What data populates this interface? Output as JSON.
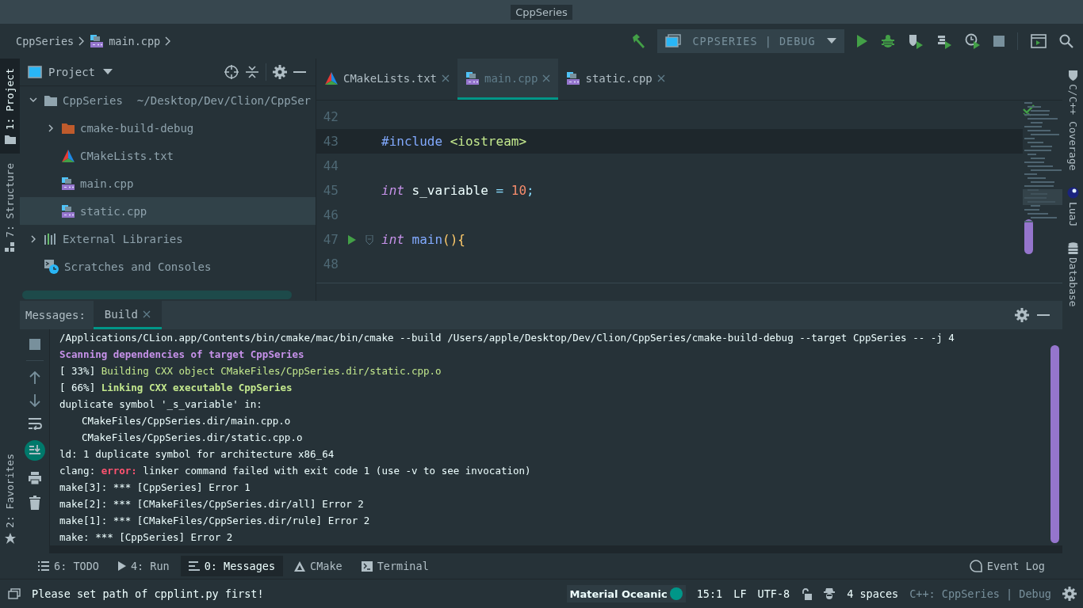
{
  "window": {
    "title": "CppSeries"
  },
  "breadcrumbs": [
    {
      "label": "CppSeries",
      "kind": "project"
    },
    {
      "label": "main.cpp",
      "kind": "source"
    }
  ],
  "run_config": {
    "label": "CPPSERIES | DEBUG"
  },
  "left_stripe_top": [
    {
      "label": "1: Project",
      "selected": true
    },
    {
      "label": "7: Structure",
      "selected": false
    }
  ],
  "left_stripe_bottom": [
    {
      "label": "2: Favorites",
      "selected": false
    }
  ],
  "right_stripe": [
    {
      "label": "C/C++ Coverage"
    },
    {
      "label": "LuaJ"
    },
    {
      "label": "Database"
    }
  ],
  "project": {
    "title": "Project",
    "tree": [
      {
        "label": "CppSeries",
        "path": "~/Desktop/Dev/Clion/CppSer",
        "kind": "folder",
        "expanded": true,
        "selected": false,
        "children": [
          {
            "label": "cmake-build-debug",
            "kind": "build-folder",
            "expanded": false,
            "selected": false
          },
          {
            "label": "CMakeLists.txt",
            "kind": "cmake",
            "selected": false
          },
          {
            "label": "main.cpp",
            "kind": "source",
            "selected": false
          },
          {
            "label": "static.cpp",
            "kind": "source",
            "selected": true
          }
        ]
      },
      {
        "label": "External Libraries",
        "kind": "libraries",
        "expanded": false,
        "selected": false
      },
      {
        "label": "Scratches and Consoles",
        "kind": "scratches",
        "selected": false
      }
    ]
  },
  "editor": {
    "tabs": [
      {
        "label": "CMakeLists.txt",
        "kind": "cmake",
        "selected": false
      },
      {
        "label": "main.cpp",
        "kind": "source",
        "selected": true
      },
      {
        "label": "static.cpp",
        "kind": "source",
        "selected": false
      }
    ],
    "lines": [
      {
        "number": "42",
        "selected": false,
        "run": false,
        "fold": false
      },
      {
        "number": "43",
        "selected": true,
        "run": false,
        "fold": false,
        "tokens": [
          {
            "text": "#include ",
            "kind": "directive"
          },
          {
            "text": "<iostream>",
            "kind": "string"
          }
        ]
      },
      {
        "number": "44",
        "selected": false,
        "run": false,
        "fold": false
      },
      {
        "number": "45",
        "selected": false,
        "run": false,
        "fold": false,
        "tokens": [
          {
            "text": "int",
            "kind": "keyword"
          },
          {
            "text": " s_variable ",
            "kind": "ident"
          },
          {
            "text": "=",
            "kind": "op"
          },
          {
            "text": " 10",
            "kind": "number"
          },
          {
            "text": ";",
            "kind": "op"
          }
        ]
      },
      {
        "number": "46",
        "selected": false,
        "run": false,
        "fold": false
      },
      {
        "number": "47",
        "selected": false,
        "run": true,
        "fold": true,
        "tokens": [
          {
            "text": "int",
            "kind": "keyword"
          },
          {
            "text": " main",
            "kind": "func"
          },
          {
            "text": "(){",
            "kind": "paren"
          }
        ]
      },
      {
        "number": "48",
        "selected": false,
        "run": false,
        "fold": false
      }
    ]
  },
  "messages": {
    "label": "Messages:",
    "tabs": [
      {
        "label": "Build",
        "selected": true
      }
    ],
    "autoscroll": true,
    "output": [
      {
        "indent": false,
        "segments": [
          {
            "text": "/Applications/CLion.app/Contents/bin/cmake/mac/bin/cmake --build /Users/apple/Desktop/Dev/Clion/CppSeries/cmake-build-debug --target CppSeries -- -j 4",
            "kind": "plain"
          }
        ]
      },
      {
        "indent": false,
        "segments": [
          {
            "text": "Scanning dependencies of target CppSeries",
            "kind": "info"
          }
        ]
      },
      {
        "indent": false,
        "segments": [
          {
            "text": "[ 33%] ",
            "kind": "plain"
          },
          {
            "text": "Building CXX object CMakeFiles/CppSeries.dir/static.cpp.o",
            "kind": "progress"
          }
        ]
      },
      {
        "indent": false,
        "segments": [
          {
            "text": "[ 66%] ",
            "kind": "plain"
          },
          {
            "text": "Linking CXX executable CppSeries",
            "kind": "link"
          }
        ]
      },
      {
        "indent": false,
        "segments": [
          {
            "text": "duplicate symbol '_s_variable' in:",
            "kind": "plain"
          }
        ]
      },
      {
        "indent": true,
        "segments": [
          {
            "text": "CMakeFiles/CppSeries.dir/main.cpp.o",
            "kind": "plain"
          }
        ]
      },
      {
        "indent": true,
        "segments": [
          {
            "text": "CMakeFiles/CppSeries.dir/static.cpp.o",
            "kind": "plain"
          }
        ]
      },
      {
        "indent": false,
        "segments": [
          {
            "text": "ld: 1 duplicate symbol for architecture x86_64",
            "kind": "plain"
          }
        ]
      },
      {
        "indent": false,
        "segments": [
          {
            "text": "clang: ",
            "kind": "plain"
          },
          {
            "text": "error:",
            "kind": "error"
          },
          {
            "text": " linker command failed with exit code 1 (use -v to see invocation)",
            "kind": "plain"
          }
        ]
      },
      {
        "indent": false,
        "segments": [
          {
            "text": "make[3]: *** [CppSeries] Error 1",
            "kind": "plain"
          }
        ]
      },
      {
        "indent": false,
        "segments": [
          {
            "text": "make[2]: *** [CMakeFiles/CppSeries.dir/all] Error 2",
            "kind": "plain"
          }
        ]
      },
      {
        "indent": false,
        "segments": [
          {
            "text": "make[1]: *** [CMakeFiles/CppSeries.dir/rule] Error 2",
            "kind": "plain"
          }
        ]
      },
      {
        "indent": false,
        "segments": [
          {
            "text": "make: *** [CppSeries] Error 2",
            "kind": "plain"
          }
        ]
      }
    ]
  },
  "tool_windows": [
    {
      "label": "6: TODO",
      "selected": false
    },
    {
      "label": "4: Run",
      "selected": false
    },
    {
      "label": "0: Messages",
      "selected": true
    },
    {
      "label": "CMake",
      "selected": false
    },
    {
      "label": "Terminal",
      "selected": false
    }
  ],
  "event_log": {
    "label": "Event Log"
  },
  "status": {
    "message": "Please set path of cpplint.py first!",
    "items": [
      {
        "kind": "theme",
        "text": "Material Oceanic"
      },
      {
        "kind": "text",
        "text": "15:1"
      },
      {
        "kind": "text",
        "text": "LF"
      },
      {
        "kind": "text",
        "text": "UTF-8"
      },
      {
        "kind": "lock"
      },
      {
        "kind": "inspector"
      },
      {
        "kind": "text",
        "text": "4 spaces"
      },
      {
        "kind": "context",
        "text": "C++: CppSeries | Debug"
      },
      {
        "kind": "gear"
      }
    ]
  }
}
